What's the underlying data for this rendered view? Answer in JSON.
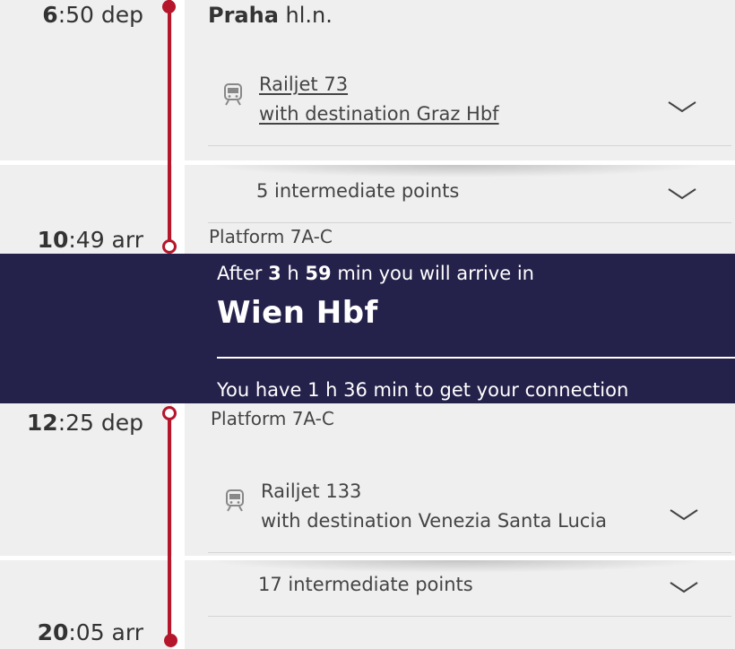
{
  "segment1": {
    "departure": {
      "hour": "6",
      "rest": ":50 dep"
    },
    "station": {
      "bold": "Praha",
      "rest": " hl.n."
    },
    "train": {
      "line1": "Railjet 73",
      "line2": "with destination Graz Hbf"
    },
    "intermediate": "5 intermediate points",
    "arrival": {
      "hour": "10",
      "rest": ":49 arr"
    },
    "arrival_platform": "Platform 7A-C"
  },
  "transfer": {
    "after_prefix": "After ",
    "hours": "3",
    "h_sep": " h ",
    "minutes": "59",
    "after_suffix": " min you will arrive in",
    "city": "Wien Hbf",
    "connection_text": "You have 1 h 36 min to get your connection"
  },
  "segment2": {
    "departure": {
      "hour": "12",
      "rest": ":25 dep"
    },
    "departure_platform": "Platform 7A-C",
    "train": {
      "line1": "Railjet 133",
      "line2": "with destination Venezia Santa Lucia"
    },
    "intermediate": "17 intermediate points",
    "arrival": {
      "hour": "20",
      "rest": ":05 arr"
    }
  },
  "colors": {
    "accent": "#b5162b",
    "banner": "#24214a",
    "background": "#efefef"
  },
  "icons": {
    "train": "train-icon",
    "expand": "chevron-down-icon"
  }
}
